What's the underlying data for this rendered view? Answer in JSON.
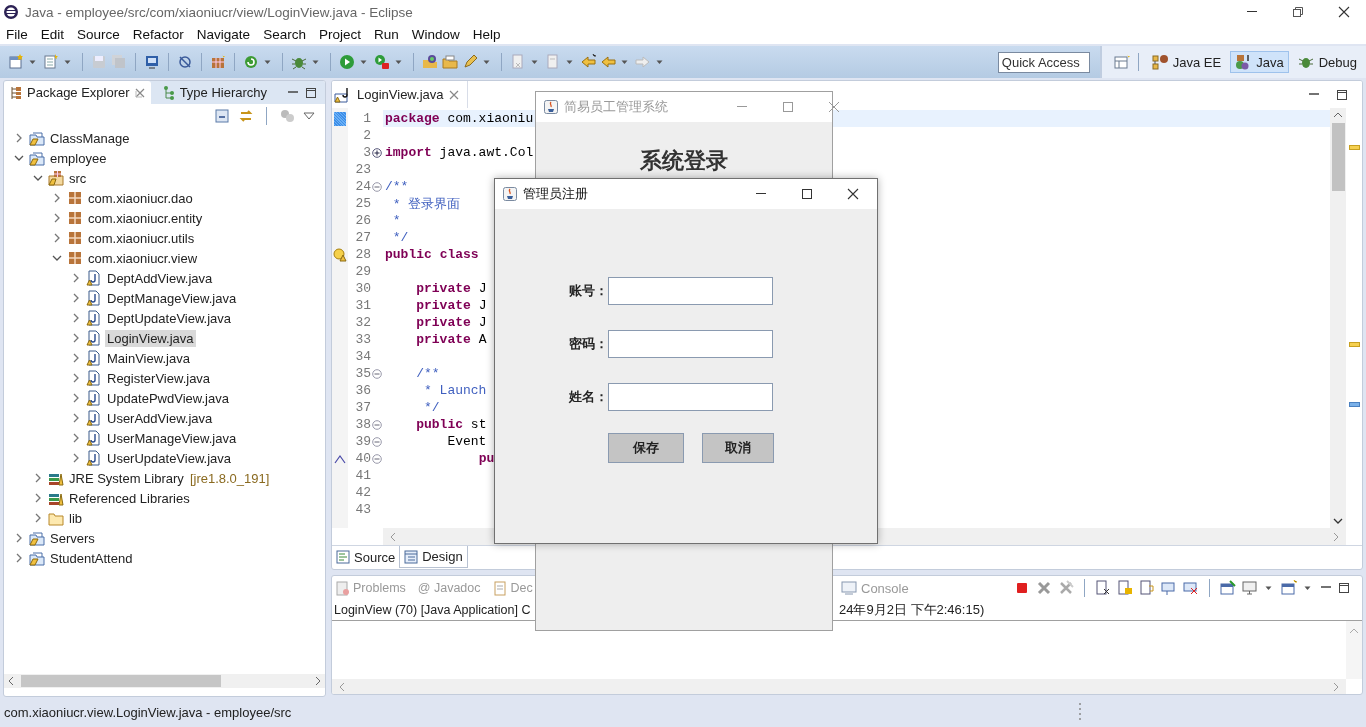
{
  "window": {
    "title": "Java - employee/src/com/xiaoniucr/view/LoginView.java - Eclipse"
  },
  "menu": [
    "File",
    "Edit",
    "Source",
    "Refactor",
    "Navigate",
    "Search",
    "Project",
    "Run",
    "Window",
    "Help"
  ],
  "quick_access": {
    "placeholder": "Quick Access"
  },
  "perspectives": [
    {
      "label": "Java EE",
      "selected": false
    },
    {
      "label": "Java",
      "selected": true
    },
    {
      "label": "Debug",
      "selected": false
    }
  ],
  "explorer": {
    "tabs": [
      {
        "label": "Package Explorer",
        "selected": true
      },
      {
        "label": "Type Hierarchy",
        "selected": false
      }
    ],
    "tree": [
      {
        "label": "ClassManage",
        "kind": "project",
        "expanded": false,
        "selected": false
      },
      {
        "label": "employee",
        "kind": "project",
        "expanded": true,
        "selected": false,
        "children": [
          {
            "label": "src",
            "kind": "source-folder",
            "expanded": true,
            "selected": false,
            "children": [
              {
                "label": "com.xiaoniucr.dao",
                "kind": "package",
                "expanded": false,
                "selected": false
              },
              {
                "label": "com.xiaoniucr.entity",
                "kind": "package",
                "expanded": false,
                "selected": false
              },
              {
                "label": "com.xiaoniucr.utils",
                "kind": "package",
                "expanded": false,
                "selected": false
              },
              {
                "label": "com.xiaoniucr.view",
                "kind": "package",
                "expanded": true,
                "selected": false,
                "children": [
                  {
                    "label": "DeptAddView.java",
                    "kind": "java-file",
                    "expanded": false,
                    "selected": false
                  },
                  {
                    "label": "DeptManageView.java",
                    "kind": "java-file",
                    "expanded": false,
                    "selected": false
                  },
                  {
                    "label": "DeptUpdateView.java",
                    "kind": "java-file",
                    "expanded": false,
                    "selected": false
                  },
                  {
                    "label": "LoginView.java",
                    "kind": "java-file",
                    "expanded": false,
                    "selected": true
                  },
                  {
                    "label": "MainView.java",
                    "kind": "java-file",
                    "expanded": false,
                    "selected": false
                  },
                  {
                    "label": "RegisterView.java",
                    "kind": "java-file",
                    "expanded": false,
                    "selected": false
                  },
                  {
                    "label": "UpdatePwdView.java",
                    "kind": "java-file",
                    "expanded": false,
                    "selected": false
                  },
                  {
                    "label": "UserAddView.java",
                    "kind": "java-file",
                    "expanded": false,
                    "selected": false
                  },
                  {
                    "label": "UserManageView.java",
                    "kind": "java-file",
                    "expanded": false,
                    "selected": false
                  },
                  {
                    "label": "UserUpdateView.java",
                    "kind": "java-file",
                    "expanded": false,
                    "selected": false
                  }
                ]
              }
            ]
          },
          {
            "label": "JRE System Library",
            "decoration": "[jre1.8.0_191]",
            "kind": "library",
            "expanded": false,
            "selected": false
          },
          {
            "label": "Referenced Libraries",
            "kind": "library",
            "expanded": false,
            "selected": false
          },
          {
            "label": "lib",
            "kind": "folder",
            "expanded": false,
            "selected": false
          }
        ]
      },
      {
        "label": "Servers",
        "kind": "project",
        "expanded": false,
        "selected": false
      },
      {
        "label": "StudentAttend",
        "kind": "project",
        "expanded": false,
        "selected": false
      }
    ]
  },
  "editor": {
    "tab": {
      "label": "LoginView.java"
    },
    "lines": [
      {
        "number": "1",
        "text": "**package** com.xiaoniu",
        "kind": "code",
        "current": true
      },
      {
        "number": "2",
        "kind": "code",
        "current": false
      },
      {
        "number": "3",
        "text": "**import** java.awt.Col",
        "kind": "code",
        "current": false,
        "collapsed": true
      },
      {
        "number": "23",
        "kind": "code",
        "current": false
      },
      {
        "number": "24",
        "text": "/**",
        "kind": "comment",
        "current": false,
        "collapsed": false
      },
      {
        "number": "25",
        "text": " * 登录界面",
        "kind": "comment",
        "current": false
      },
      {
        "number": "26",
        "text": " *",
        "kind": "comment",
        "current": false
      },
      {
        "number": "27",
        "text": " */",
        "kind": "comment",
        "current": false
      },
      {
        "number": "28",
        "text": "**public** **class**",
        "kind": "code",
        "current": false,
        "warning": true
      },
      {
        "number": "29",
        "kind": "code",
        "current": false
      },
      {
        "number": "30",
        "text": "    **private** J",
        "kind": "code",
        "current": false
      },
      {
        "number": "31",
        "text": "    **private** J",
        "kind": "code",
        "current": false
      },
      {
        "number": "32",
        "text": "    **private** J",
        "kind": "code",
        "current": false
      },
      {
        "number": "33",
        "text": "    **private** A",
        "kind": "code",
        "current": false
      },
      {
        "number": "34",
        "kind": "code",
        "current": false
      },
      {
        "number": "35",
        "text": "    /**",
        "kind": "comment",
        "current": false,
        "collapsed": false
      },
      {
        "number": "36",
        "text": "     * Launch",
        "kind": "comment",
        "current": false
      },
      {
        "number": "37",
        "text": "     */",
        "kind": "comment",
        "current": false
      },
      {
        "number": "38",
        "text": "    **public** st",
        "kind": "code",
        "current": false,
        "collapsed": false
      },
      {
        "number": "39",
        "text": "        Event",
        "kind": "code",
        "current": false,
        "collapsed": false
      },
      {
        "number": "40",
        "text": "            **pu**",
        "kind": "code",
        "current": false,
        "collapsed": false,
        "override": true
      },
      {
        "number": "41",
        "kind": "code",
        "current": false
      },
      {
        "number": "42",
        "kind": "code",
        "current": false
      },
      {
        "number": "43",
        "kind": "code",
        "current": false
      }
    ],
    "bottom_tabs": [
      {
        "label": "Source",
        "selected": false
      },
      {
        "label": "Design",
        "selected": true
      }
    ]
  },
  "console": {
    "tabs": [
      {
        "label": "Problems"
      },
      {
        "label": "@ Javadoc"
      },
      {
        "label": "Dec"
      },
      {
        "label": "Console"
      }
    ],
    "info": [
      "LoginView (70) [Java Application] C",
      "24年9月2日 下午2:46:15)"
    ]
  },
  "status_bar": {
    "text": "com.xiaoniucr.view.LoginView.java - employee/src"
  },
  "login_window": {
    "title": "简易员工管理系统",
    "heading": "系统登录"
  },
  "register_dialog": {
    "title": "管理员注册",
    "fields": [
      {
        "label": "账号："
      },
      {
        "label": "密码："
      },
      {
        "label": "姓名："
      }
    ],
    "buttons": [
      "保存",
      "取消"
    ]
  }
}
